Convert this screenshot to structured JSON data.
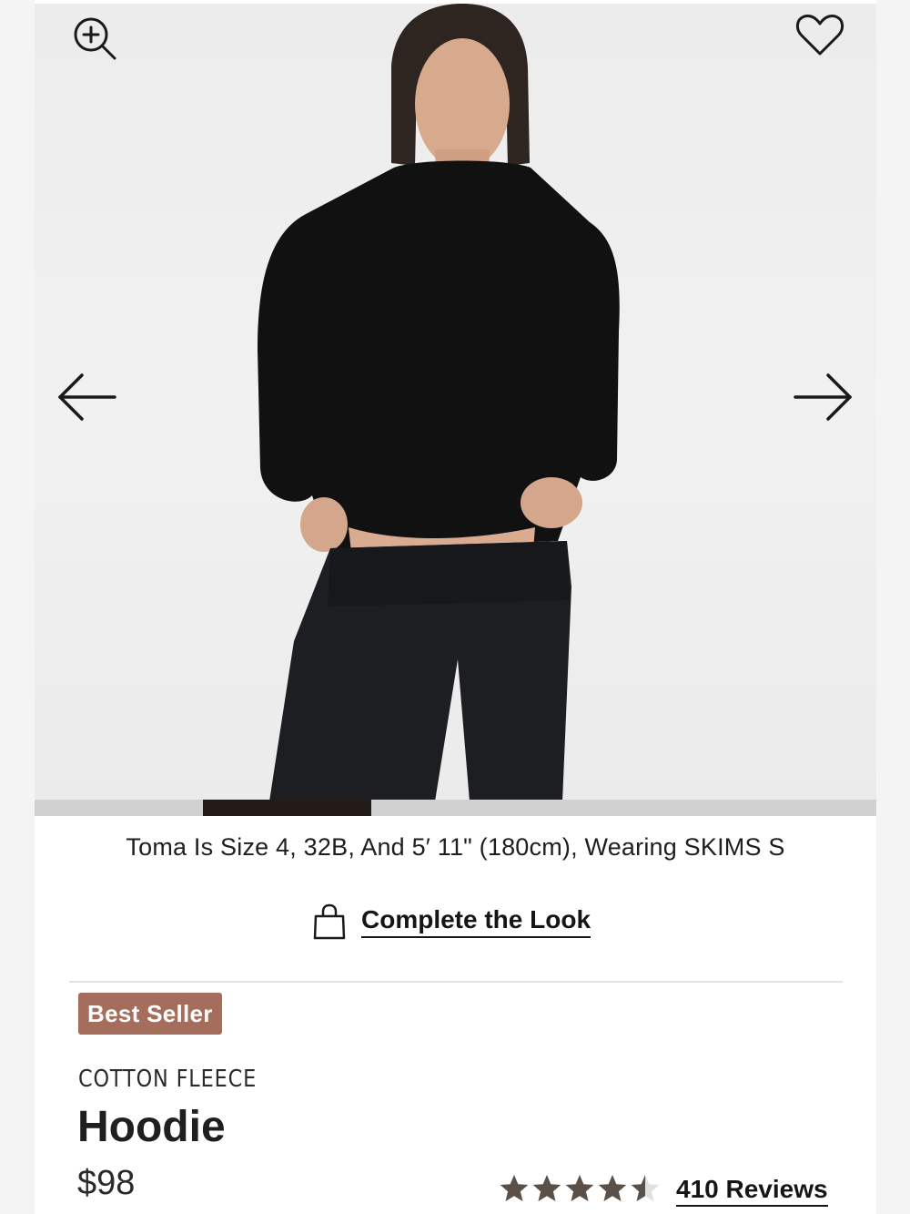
{
  "product_image": {
    "alt": "Model wearing black cotton fleece hoodie and black leggings"
  },
  "icons": {
    "zoom": "zoom-in-icon",
    "wishlist": "heart-icon",
    "prev": "arrow-left-icon",
    "next": "arrow-right-icon",
    "bag": "shopping-bag-icon",
    "star": "star-icon"
  },
  "carousel": {
    "progress_start_fraction": 0.2,
    "progress_end_fraction": 0.4
  },
  "model_info": "Toma Is Size 4, 32B, And 5′ 11\" (180cm), Wearing SKIMS S",
  "complete_look_label": "Complete the Look",
  "badge": "Best Seller",
  "collection": "COTTON FLEECE",
  "product_name": "Hoodie",
  "price": "$98",
  "rating": {
    "value": 4.5,
    "max": 5,
    "reviews_label": "410 Reviews"
  },
  "colors": {
    "badge_bg": "#a56e5c",
    "star_fill": "#5a5048",
    "star_empty": "#e0e0e0",
    "progress_track": "#d2d1d1",
    "progress_fill": "#221b17"
  }
}
